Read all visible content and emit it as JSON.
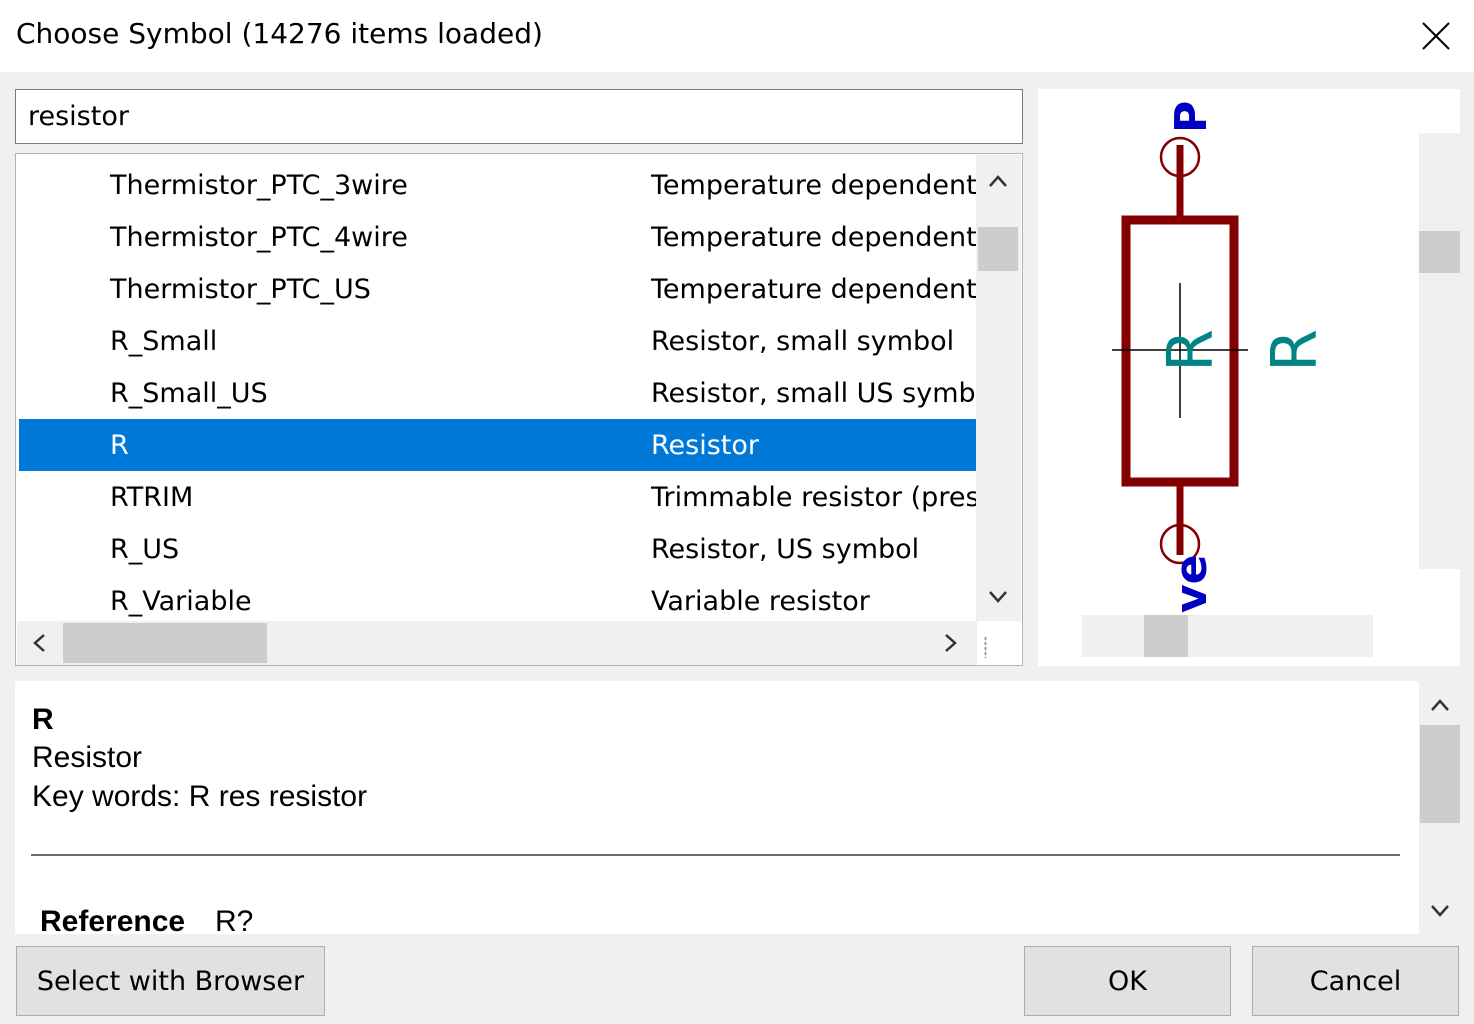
{
  "window": {
    "title": "Choose Symbol (14276 items loaded)"
  },
  "icons": {
    "close": "close-icon",
    "up": "chevron-up-icon",
    "down": "chevron-down-icon",
    "left": "chevron-left-icon",
    "right": "chevron-right-icon"
  },
  "search": {
    "value": "resistor"
  },
  "list": {
    "rows": [
      {
        "name": "Thermistor_PTC_3wire",
        "desc": "Temperature dependent"
      },
      {
        "name": "Thermistor_PTC_4wire",
        "desc": "Temperature dependent"
      },
      {
        "name": "Thermistor_PTC_US",
        "desc": "Temperature dependent"
      },
      {
        "name": "R_Small",
        "desc": "Resistor, small symbol"
      },
      {
        "name": "R_Small_US",
        "desc": "Resistor, small US symbo"
      },
      {
        "name": "R",
        "desc": "Resistor"
      },
      {
        "name": "RTRIM",
        "desc": "Trimmable resistor (prese"
      },
      {
        "name": "R_US",
        "desc": "Resistor, US symbol"
      },
      {
        "name": "R_Variable",
        "desc": "Variable resistor"
      }
    ],
    "selected_index": 5
  },
  "preview": {
    "ref_text": "R",
    "value_text": "R",
    "pin_top_label": "P",
    "pin_bottom_label": "ve",
    "colors": {
      "body": "#840000",
      "text": "#008484",
      "pin_label": "#0000c2",
      "pin_circle": "#840000"
    }
  },
  "info": {
    "name": "R",
    "description": "Resistor",
    "keywords": "Key words: R res resistor",
    "reference_label": "Reference",
    "reference_value": "R?"
  },
  "buttons": {
    "browser": "Select with Browser",
    "ok": "OK",
    "cancel": "Cancel"
  },
  "colors": {
    "selection": "#0078d7",
    "window_bg": "#f0f0f0"
  }
}
